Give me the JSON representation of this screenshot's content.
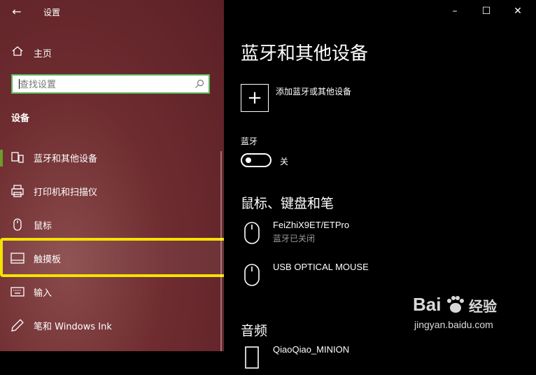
{
  "window": {
    "title": "设置",
    "back_icon": "back-arrow-icon",
    "minimize_glyph": "–",
    "maximize_glyph": "☐",
    "close_glyph": "✕"
  },
  "sidebar": {
    "home": {
      "label": "主页",
      "icon": "home-icon"
    },
    "search": {
      "placeholder": "查找设置",
      "icon": "search-icon"
    },
    "section_title": "设备",
    "items": [
      {
        "label": "蓝牙和其他设备",
        "icon": "bluetooth-devices-icon",
        "active": true
      },
      {
        "label": "打印机和扫描仪",
        "icon": "printer-icon"
      },
      {
        "label": "鼠标",
        "icon": "mouse-icon"
      },
      {
        "label": "触摸板",
        "icon": "touchpad-icon",
        "highlighted": true
      },
      {
        "label": "输入",
        "icon": "keyboard-icon"
      },
      {
        "label": "笔和 Windows Ink",
        "icon": "pen-icon"
      }
    ],
    "highlight_color": "#f4e200",
    "active_indicator_color": "#6a9e28"
  },
  "main": {
    "title": "蓝牙和其他设备",
    "add_device": {
      "label": "添加蓝牙或其他设备",
      "glyph": "+"
    },
    "bluetooth": {
      "label": "蓝牙",
      "state": "关",
      "on": false
    },
    "mouse_section": {
      "title": "鼠标、键盘和笔",
      "devices": [
        {
          "name": "FeiZhiX9ET/ETPro",
          "status": "蓝牙已关闭",
          "icon": "mouse-icon"
        },
        {
          "name": "USB OPTICAL MOUSE",
          "status": "",
          "icon": "mouse-icon"
        }
      ]
    },
    "audio_section": {
      "title": "音频",
      "devices": [
        {
          "name": "QiaoQiao_MINION",
          "icon": "speaker-icon"
        }
      ]
    }
  },
  "watermark": {
    "logo": "Bai",
    "brand": "经验",
    "url": "jingyan.baidu.com"
  }
}
